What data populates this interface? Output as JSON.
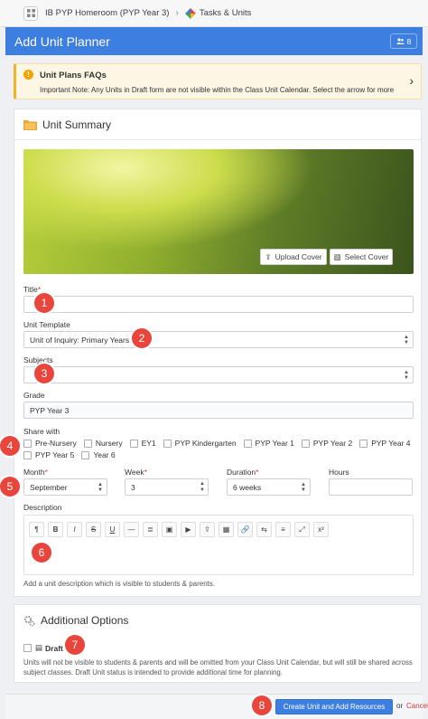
{
  "breadcrumb": {
    "class_name": "IB PYP Homeroom (PYP Year 3)",
    "section": "Tasks & Units"
  },
  "header": {
    "title": "Add Unit Planner",
    "user_count": "8"
  },
  "faq": {
    "title": "Unit Plans FAQs",
    "note": "Important Note: Any Units in Draft form are not visible within the Class Unit Calendar. Select the arrow for more"
  },
  "summary": {
    "title": "Unit Summary",
    "upload_cover": "Upload Cover",
    "select_cover": "Select Cover",
    "title_label": "Title",
    "title_value": "",
    "template_label": "Unit Template",
    "template_value": "Unit of Inquiry: Primary Years",
    "subjects_label": "Subjects",
    "subjects_value": "",
    "grade_label": "Grade",
    "grade_value": "PYP Year 3",
    "share_label": "Share with",
    "share_options": [
      "Pre-Nursery",
      "Nursery",
      "EY1",
      "PYP Kindergarten",
      "PYP Year 1",
      "PYP Year 2",
      "PYP Year 4",
      "PYP Year 5",
      "Year 6"
    ],
    "month_label": "Month",
    "month_value": "September",
    "week_label": "Week",
    "week_value": "3",
    "duration_label": "Duration",
    "duration_value": "6 weeks",
    "hours_label": "Hours",
    "hours_value": "",
    "description_label": "Description",
    "description_hint": "Add a unit description which is visible to students & parents.",
    "toolbar": [
      "¶",
      "B",
      "I",
      "S",
      "U",
      "—",
      "≣",
      "▣",
      "▶",
      "⇪",
      "▦",
      "🔗",
      "⇆",
      "≡",
      "⤢",
      "x²"
    ]
  },
  "options": {
    "title": "Additional Options",
    "draft_label": "Draft",
    "draft_note": "Units will not be visible to students & parents and will be omitted from your Class Unit Calendar, but will still be shared across subject classes. Draft Unit status is intended to provide additional time for planning."
  },
  "footer": {
    "primary": "Create Unit and Add Resources",
    "or": "or",
    "cancel": "Cancel"
  },
  "markers": [
    "1",
    "2",
    "3",
    "4",
    "5",
    "6",
    "7",
    "8"
  ],
  "colors": {
    "accent": "#3d7fe0",
    "marker": "#e8453c",
    "warning": "#f0b429"
  }
}
